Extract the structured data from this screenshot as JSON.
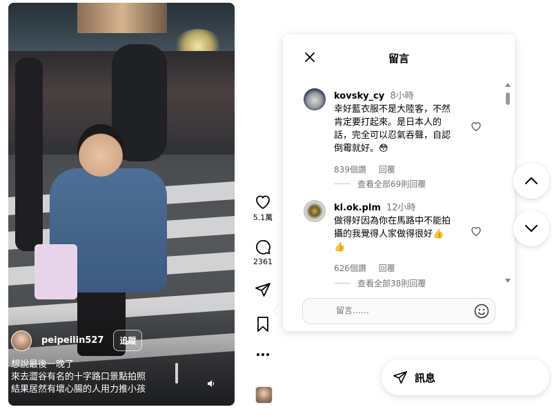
{
  "video": {
    "username": "peipeilin527",
    "follow_label": "追蹤",
    "caption": [
      "想說最後一晚了",
      "來去澀谷有名的十字路口景點拍照",
      "結果居然有壞心腸的人用力推小孩"
    ]
  },
  "actions": {
    "likes": "5.1萬",
    "comments": "2361"
  },
  "panel": {
    "title": "留言",
    "comments": [
      {
        "user": "kovsky_cy",
        "time": "8小時",
        "lines": [
          "幸好藍衣服不是大陸客，不然",
          "肯定要打起來。是日本人的",
          "話，完全可以忍氣吞聲，自認",
          "倒霉就好。😳"
        ],
        "likes": "839個讚",
        "reply": "回覆",
        "view_replies": "查看全部69則回覆"
      },
      {
        "user": "kl.ok.plm",
        "time": "12小時",
        "lines": [
          "做得好因為你在馬路中不能拍",
          "攝的我覺得人家做得很好👍",
          "👍"
        ],
        "likes": "626個讚",
        "reply": "回覆",
        "view_replies": "查看全部38則回覆"
      }
    ],
    "input_placeholder": "留言……"
  },
  "message_button": {
    "label": "訊息"
  }
}
